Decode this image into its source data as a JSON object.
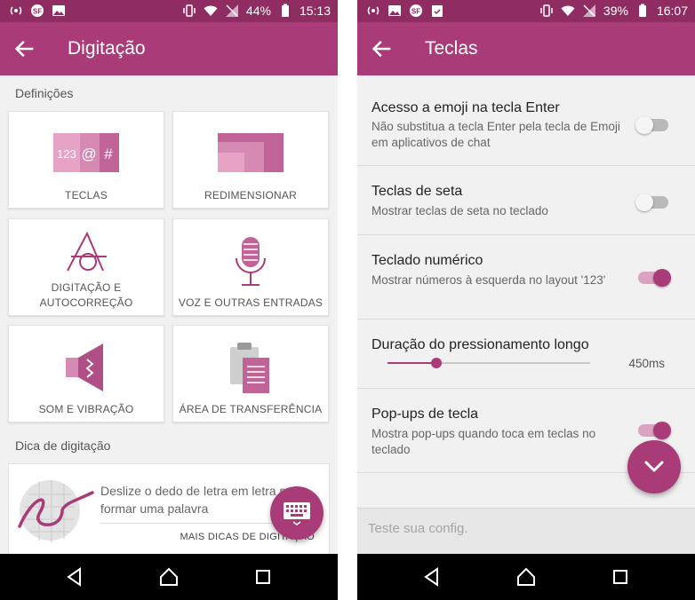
{
  "colors": {
    "status_bar": "#8f2d63",
    "app_bar": "#a83b78",
    "accent": "#a83b78",
    "background": "#f1f1f1"
  },
  "left": {
    "status": {
      "battery": "44%",
      "time": "15:13"
    },
    "title": "Digitação",
    "section_settings": "Definições",
    "tiles": [
      {
        "label": "TECLAS",
        "icon": "keys-icon"
      },
      {
        "label": "REDIMENSIONAR",
        "icon": "resize-icon"
      },
      {
        "label_line1": "DIGITAÇÃO E",
        "label_line2": "AUTOCORREÇÃO",
        "icon": "typing-autocorrect-icon"
      },
      {
        "label": "VOZ E OUTRAS ENTRADAS",
        "icon": "microphone-icon"
      },
      {
        "label": "SOM E VIBRAÇÃO",
        "icon": "speaker-icon"
      },
      {
        "label": "ÁREA DE TRANSFERÊNCIA",
        "icon": "clipboard-icon"
      }
    ],
    "section_tip": "Dica de digitação",
    "tip": {
      "text": "Deslize o dedo de letra em letra para formar uma palavra",
      "link": "MAIS DICAS DE DIGITAÇÃO"
    }
  },
  "right": {
    "status": {
      "battery": "39%",
      "time": "16:07"
    },
    "title": "Teclas",
    "settings": [
      {
        "title": "Acesso a emoji na tecla Enter",
        "subtitle": "Não substitua a tecla Enter pela tecla de Emoji em aplicativos de chat",
        "enabled": false
      },
      {
        "title": "Teclas de seta",
        "subtitle": "Mostrar teclas de seta no teclado",
        "enabled": false
      },
      {
        "title": "Teclado numérico",
        "subtitle": "Mostrar números à esquerda no layout '123'",
        "enabled": true
      },
      {
        "title": "Duração do pressionamento longo",
        "value": "450ms",
        "value_fraction": 0.24
      },
      {
        "title": "Pop-ups de tecla",
        "subtitle": "Mostra pop-ups quando toca em teclas no teclado",
        "enabled": true
      }
    ],
    "test_placeholder": "Teste sua config."
  }
}
